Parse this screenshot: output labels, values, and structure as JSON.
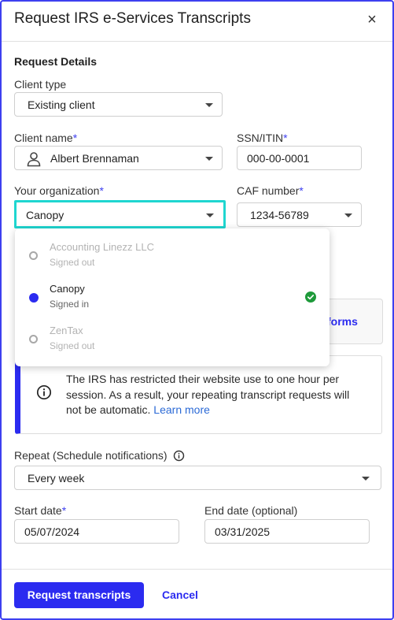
{
  "modal": {
    "title": "Request IRS e-Services Transcripts",
    "close_label": "×"
  },
  "form": {
    "section_title": "Request Details",
    "client_type": {
      "label": "Client type",
      "value": "Existing client"
    },
    "client_name": {
      "label": "Client name",
      "required_mark": "*",
      "value": "Albert Brennaman"
    },
    "ssn": {
      "label": "SSN/ITIN",
      "required_mark": "*",
      "value": "000-00-0001"
    },
    "organization": {
      "label": "Your organization",
      "required_mark": "*",
      "value": "Canopy"
    },
    "caf": {
      "label": "CAF number",
      "required_mark": "*",
      "value": "1234-56789"
    },
    "repeat": {
      "label": "Repeat (Schedule notifications)",
      "value": "Every week"
    },
    "start_date": {
      "label": "Start date",
      "required_mark": "*",
      "value": "05/07/2024"
    },
    "end_date": {
      "label": "End date (optional)",
      "value": "03/31/2025"
    }
  },
  "org_dropdown": {
    "options": [
      {
        "name": "Accounting Linezz LLC",
        "status": "Signed out",
        "selected": false
      },
      {
        "name": "Canopy",
        "status": "Signed in",
        "selected": true
      },
      {
        "name": "ZenTax",
        "status": "Signed out",
        "selected": false
      }
    ]
  },
  "obscured_panel": {
    "link_text": "forms"
  },
  "notice": {
    "text": "The IRS has restricted their website use to one hour per session. As a result, your repeating transcript requests will not be automatic.",
    "link": "Learn more"
  },
  "footer": {
    "primary_label": "Request transcripts",
    "cancel_label": "Cancel"
  },
  "colors": {
    "accent": "#2b2bf0",
    "focus_ring": "#1fd6d0",
    "success": "#1e9a3a"
  },
  "icons": [
    "close-icon",
    "user-icon",
    "caret-down-icon",
    "radio-icon",
    "check-circle-icon",
    "info-icon"
  ]
}
